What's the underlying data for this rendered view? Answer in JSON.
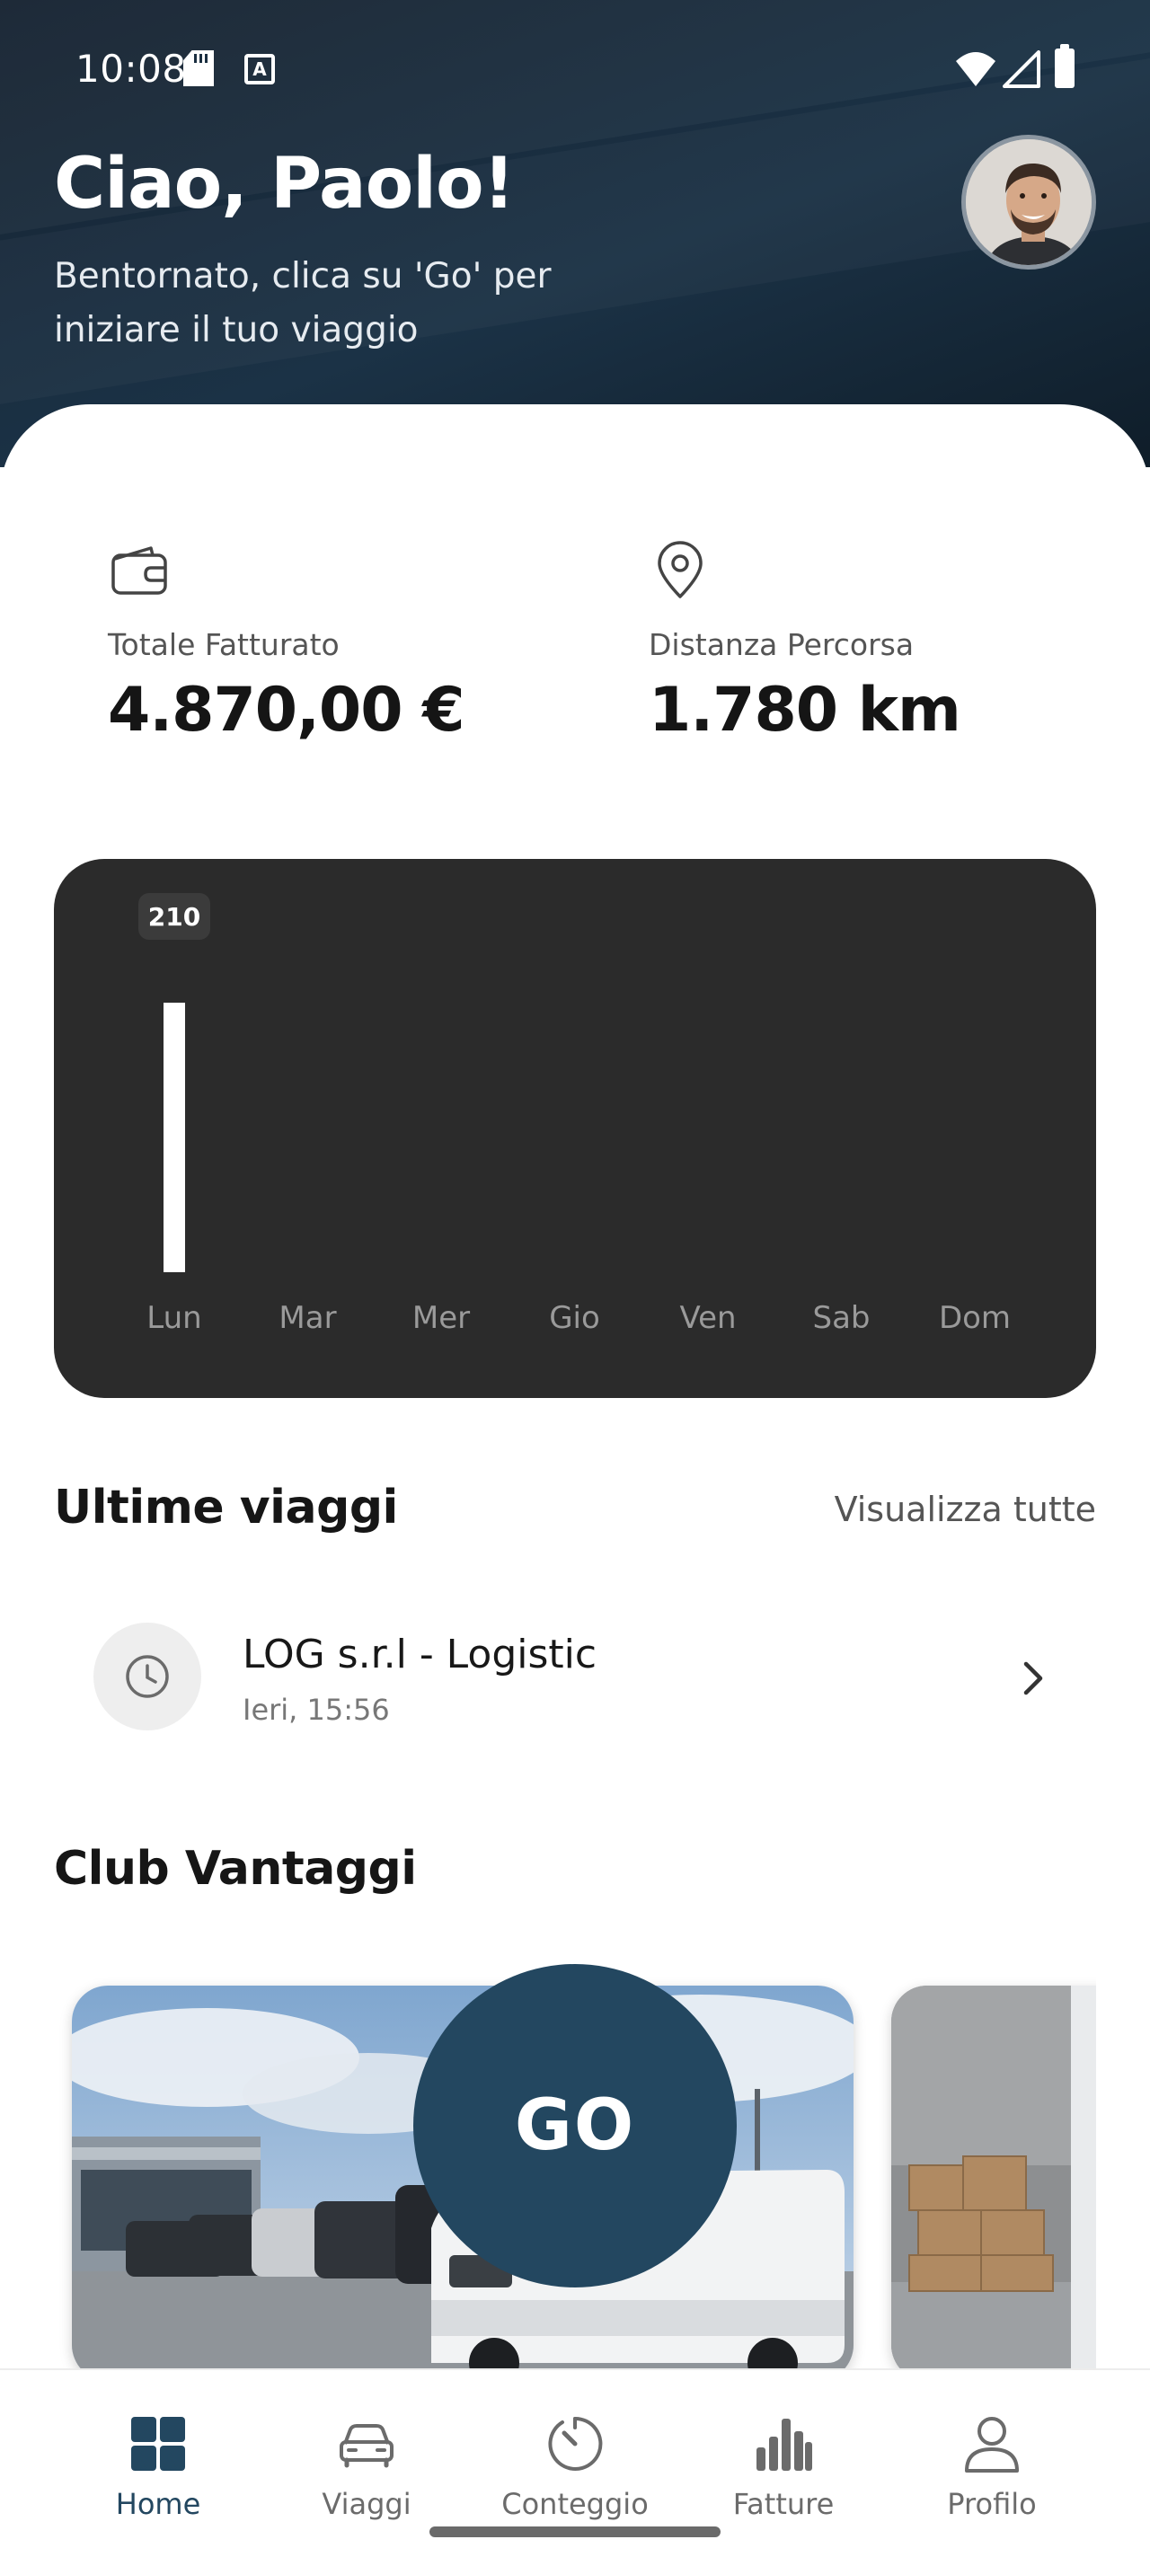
{
  "status_bar": {
    "time": "10:08",
    "icons": [
      "sd-card-icon",
      "a-keyboard-icon",
      "wifi-icon",
      "signal-icon",
      "battery-icon"
    ]
  },
  "header": {
    "greeting": "Ciao, Paolo!",
    "subtitle": "Bentornato, clica su 'Go' per iniziare il tuo viaggio",
    "avatar": "profile-photo"
  },
  "stats": [
    {
      "icon": "wallet-icon",
      "label": "Totale Fatturato",
      "value": "4.870,00 €"
    },
    {
      "icon": "location-pin-icon",
      "label": "Distanza Percorsa",
      "value": "1.780 km"
    }
  ],
  "chart_data": {
    "type": "bar",
    "categories": [
      "Lun",
      "Mar",
      "Mer",
      "Gio",
      "Ven",
      "Sab",
      "Dom"
    ],
    "values": [
      210,
      0,
      0,
      0,
      0,
      0,
      0
    ],
    "data_labels": [
      "210",
      "",
      "",
      "",
      "",
      "",
      ""
    ],
    "ylim": [
      0,
      210
    ],
    "grid": false,
    "bar_color": "#ffffff",
    "background": "#2b2b2b"
  },
  "recent_trips": {
    "title": "Ultime viaggi",
    "see_all": "Visualizza tutte",
    "items": [
      {
        "name": "LOG s.r.l - Logistic",
        "time": "Ieri, 15:56"
      }
    ]
  },
  "club": {
    "title": "Club Vantaggi"
  },
  "go_button": {
    "label": "GO"
  },
  "nav": {
    "items": [
      {
        "label": "Home",
        "icon": "grid-icon",
        "active": true
      },
      {
        "label": "Viaggi",
        "icon": "car-icon",
        "active": false
      },
      {
        "label": "Conteggio",
        "icon": "timer-icon",
        "active": false
      },
      {
        "label": "Fatture",
        "icon": "bar-chart-icon",
        "active": false
      },
      {
        "label": "Profilo",
        "icon": "person-icon",
        "active": false
      }
    ]
  },
  "colors": {
    "primary": "#234760",
    "header_dark": "#152230",
    "chart_bg": "#2b2b2b"
  }
}
